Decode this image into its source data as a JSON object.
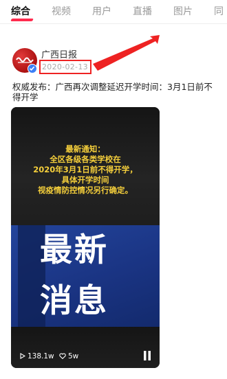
{
  "tabs": [
    {
      "label": "综合",
      "active": true
    },
    {
      "label": "视频",
      "active": false
    },
    {
      "label": "用户",
      "active": false
    },
    {
      "label": "直播",
      "active": false
    },
    {
      "label": "图片",
      "active": false
    },
    {
      "label": "同",
      "active": false
    }
  ],
  "post": {
    "author": "广西日报",
    "date": "2020-02-13",
    "caption": "权威发布：广西再次调整延迟开学时间：3月1日前不得开学"
  },
  "video": {
    "notice_lines": [
      "最新通知：",
      "全区各级各类学校在",
      "2020年3月1日前不得开学，",
      "具体开学时间",
      "视疫情防控情况另行确定。"
    ],
    "title_line1": "最新",
    "title_line2": "消息",
    "plays": "138.1w",
    "likes": "5w"
  },
  "colors": {
    "tab_accent": "#ff2b4e",
    "highlight_red": "#ee2222",
    "notice_yellow": "#f5cf3b",
    "panel_blue": "#1a3483",
    "verified_blue": "#3b7ff6"
  },
  "icons": [
    "play-count-icon",
    "heart-icon",
    "pause-icon",
    "verified-check-icon",
    "red-arrow-annotation"
  ]
}
